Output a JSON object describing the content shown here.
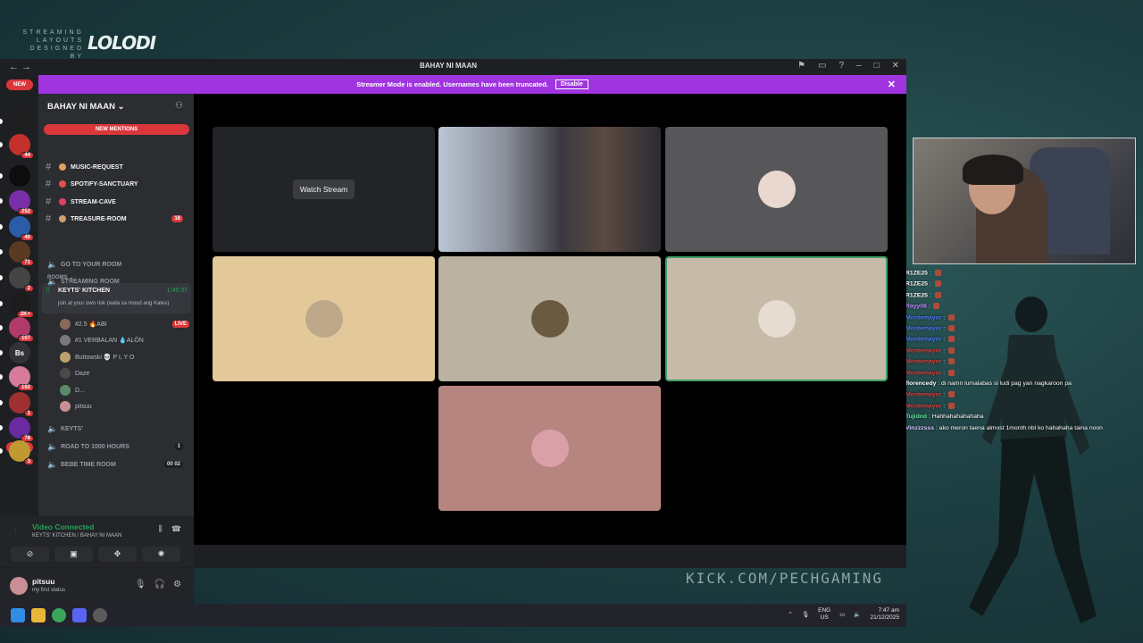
{
  "overlay": {
    "brand_small": "STREAMING LAYOUTS DESIGNED BY",
    "brand_logo": "LOLODI",
    "kick_url": "KICK.COM/PECHGAMING"
  },
  "window": {
    "title": "BAHAY NI MAAN",
    "banner_text": "Streamer Mode is enabled. Usernames have been truncated.",
    "banner_button": "Disable"
  },
  "rail": {
    "top_new": "NEW",
    "bottom_new": "NEW",
    "servers": [
      {
        "label": "",
        "badge": "",
        "color": "#1e1e1e"
      },
      {
        "label": "",
        "badge": "44",
        "color": "#c4302b"
      },
      {
        "label": "",
        "badge": "",
        "color": "#0d0d0d"
      },
      {
        "label": "",
        "badge": "252",
        "color": "#7a2ea8"
      },
      {
        "label": "",
        "badge": "40",
        "color": "#2c5ca8"
      },
      {
        "label": "",
        "badge": "71",
        "color": "#5b3a22"
      },
      {
        "label": "",
        "badge": "2",
        "color": "#444"
      },
      {
        "label": "",
        "badge": "2K+",
        "color": "#1c1c1c"
      },
      {
        "label": "",
        "badge": "107",
        "color": "#b03a6a"
      },
      {
        "label": "Bs",
        "badge": "",
        "color": "#313338"
      },
      {
        "label": "",
        "badge": "192",
        "color": "#d67b9a"
      },
      {
        "label": "",
        "badge": "1",
        "color": "#a03030"
      },
      {
        "label": "",
        "badge": "78",
        "color": "#6a2aa0"
      },
      {
        "label": "",
        "badge": "3",
        "color": "#c09a30"
      }
    ]
  },
  "sidebar": {
    "server_name": "BAHAY NI MAAN",
    "new_mentions": "NEW MENTIONS",
    "text_channels": [
      {
        "name": "MUSIC-REQUEST",
        "color": "#e0a060",
        "count": ""
      },
      {
        "name": "SPOTIFY-SANCTUARY",
        "color": "#e05050",
        "count": ""
      },
      {
        "name": "STREAM-CAVE",
        "color": "#e04060",
        "count": ""
      },
      {
        "name": "TREASURE-ROOM",
        "color": "#d0a070",
        "count": "18"
      }
    ],
    "category": "ROOMS",
    "voice_before": [
      {
        "name": "GO TO YOUR ROOM"
      },
      {
        "name": "STREAMING ROOM"
      }
    ],
    "active_channel": {
      "name": "KEYTS' KITCHEN",
      "timer": "1:45:37",
      "status": "join at your own risk (wala sa mood ang Kates)"
    },
    "voice_users": [
      {
        "name": "#2.5 🔥ABI",
        "right": "LIVE",
        "color": "#8a6a5a"
      },
      {
        "name": "#1 VERBALAN 💧ALÖN",
        "right": "",
        "color": "#7a7a7a"
      },
      {
        "name": "Buttowski 💀 P L Y O",
        "right": "",
        "color": "#c0a070"
      },
      {
        "name": "Daze",
        "right": "",
        "color": "#4a4a4a"
      },
      {
        "name": "D...",
        "right": "",
        "color": "#5a8a6a"
      },
      {
        "name": "pitsuu",
        "right": "",
        "color": "#c98f94"
      }
    ],
    "voice_after": [
      {
        "name": "KEYTS'",
        "pill": ""
      },
      {
        "name": "ROAD TO 1000 HOURS",
        "pill": "1"
      },
      {
        "name": "BEBE TIME ROOM",
        "pill": "00 02"
      }
    ]
  },
  "voice_panel": {
    "status": "Video Connected",
    "location": "KEYTS' KITCHEN / BAHAY NI MAAN"
  },
  "user_panel": {
    "username": "pitsuu",
    "status": "my first status"
  },
  "stage": {
    "watch_stream": "Watch Stream",
    "tiles": [
      {
        "kind": "stream",
        "bg": "#232428"
      },
      {
        "kind": "video",
        "bg": "#6b6f7a"
      },
      {
        "kind": "avatar",
        "bg": "#57575a",
        "av": "#e8d8d0"
      },
      {
        "kind": "avatar",
        "bg": "#e3c89a",
        "av": "#bda98a"
      },
      {
        "kind": "avatar",
        "bg": "#bcb2a2",
        "av": "#6a5a40"
      },
      {
        "kind": "avatar",
        "bg": "#c8baa8",
        "av": "#e6ddd0"
      },
      {
        "kind": "avatar",
        "bg": "#b7857f",
        "av": "#d9a0a8"
      }
    ]
  },
  "taskbar": {
    "lang": "ENG",
    "region": "US",
    "time": "7:47 am",
    "date": "21/12/2025"
  },
  "chat": [
    {
      "user": "R1ZE25",
      "text": "",
      "color": "#ffffff",
      "emote": true
    },
    {
      "user": "R1ZE25",
      "text": "",
      "color": "#ffffff",
      "emote": true
    },
    {
      "user": "R1ZE25",
      "text": "",
      "color": "#ffffff",
      "emote": true
    },
    {
      "user": "Rayy08",
      "text": "",
      "color": "#c08aff",
      "emote": true
    },
    {
      "user": "Montemayor",
      "text": "",
      "color": "#4a7cff",
      "emote": true
    },
    {
      "user": "Montemayor",
      "text": "",
      "color": "#4a7cff",
      "emote": true
    },
    {
      "user": "Montemayor",
      "text": "",
      "color": "#4a7cff",
      "emote": true
    },
    {
      "user": "Montemayor",
      "text": "",
      "color": "#e04040",
      "emote": true
    },
    {
      "user": "Montemayor",
      "text": "",
      "color": "#e04040",
      "emote": true
    },
    {
      "user": "Montemayor",
      "text": "",
      "color": "#e04040",
      "emote": true
    },
    {
      "user": "florencedy",
      "text": "di namn lumalabas si ludi pag yan nagkaroon pa",
      "color": "#ffffff",
      "emote": false
    },
    {
      "user": "Montemayor",
      "text": "",
      "color": "#e04040",
      "emote": true
    },
    {
      "user": "Montemayor",
      "text": "",
      "color": "#e04040",
      "emote": true
    },
    {
      "user": "Tujidnd",
      "text": "Hahhahahahahaha",
      "color": "#62e6a0",
      "emote": false
    },
    {
      "user": "Vinzzzsss",
      "text": "ako meron taena almost 1month nbl ko hahahaha taina noon",
      "color": "#d8c8ff",
      "emote": false
    }
  ]
}
